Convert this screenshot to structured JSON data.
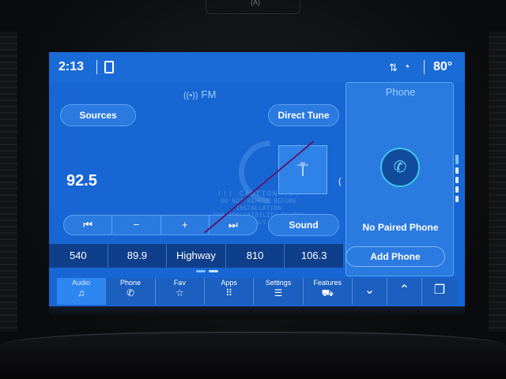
{
  "status": {
    "time": "2:13",
    "temperature": "80°",
    "phone_icon": "phone-status-icon",
    "signal_icon": "no-signal-icon",
    "wifi_icon": "wifi-icon"
  },
  "audio": {
    "source_label": "FM",
    "sources_label": "Sources",
    "direct_tune_label": "Direct Tune",
    "sound_label": "Sound",
    "frequency": "92.5",
    "watermark_line1": "!!! CAUTION !!!",
    "watermark_line2": "DO NOT REMOVE BEFORE INSTALLATION",
    "watermark_line3": "FOR ACCESSIBILITY DEVICE ONLY",
    "controls": [
      "⏮",
      "−",
      "+",
      "⏭"
    ],
    "presets": [
      "540",
      "89.9",
      "Highway",
      "810",
      "106.3"
    ]
  },
  "phone": {
    "title": "Phone",
    "status": "No Paired Phone",
    "add_phone_label": "Add Phone"
  },
  "nav": [
    {
      "label": "Audio",
      "icon": "♫"
    },
    {
      "label": "Phone",
      "icon": "✆"
    },
    {
      "label": "Fav",
      "icon": "☆"
    },
    {
      "label": "Apps",
      "icon": "⠿"
    },
    {
      "label": "Settings",
      "icon": "☰"
    },
    {
      "label": "Features",
      "icon": "⛟"
    }
  ],
  "nav_extra": {
    "down": "⌄",
    "up": "⌃",
    "windows": "❐"
  },
  "bezel": {
    "top_label": "(A)"
  },
  "colors": {
    "screen": "#1766d3",
    "accent": "#3ec5e8",
    "nav_active": "#2e86f0"
  }
}
